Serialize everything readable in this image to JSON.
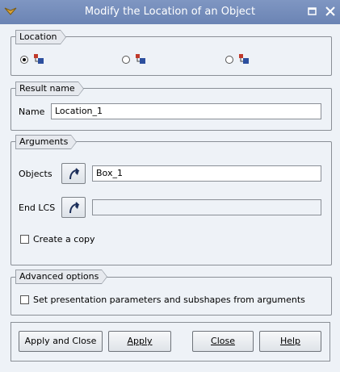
{
  "window": {
    "title": "Modify the Location of an Object"
  },
  "location": {
    "group_label": "Location",
    "options": [
      "shape-radio-option-1",
      "shape-radio-option-2",
      "shape-radio-option-3"
    ],
    "selected_index": 0
  },
  "result": {
    "group_label": "Result name",
    "name_label": "Name",
    "name_value": "Location_1"
  },
  "arguments": {
    "group_label": "Arguments",
    "objects_label": "Objects",
    "objects_value": "Box_1",
    "end_lcs_label": "End LCS",
    "end_lcs_value": "",
    "create_copy_label": "Create a copy",
    "create_copy_checked": false
  },
  "advanced": {
    "group_label": "Advanced options",
    "set_presentation_label": "Set presentation parameters and subshapes from arguments",
    "set_presentation_checked": false
  },
  "buttons": {
    "apply_and_close": "Apply and Close",
    "apply": "Apply",
    "close": "Close",
    "help": "Help"
  }
}
